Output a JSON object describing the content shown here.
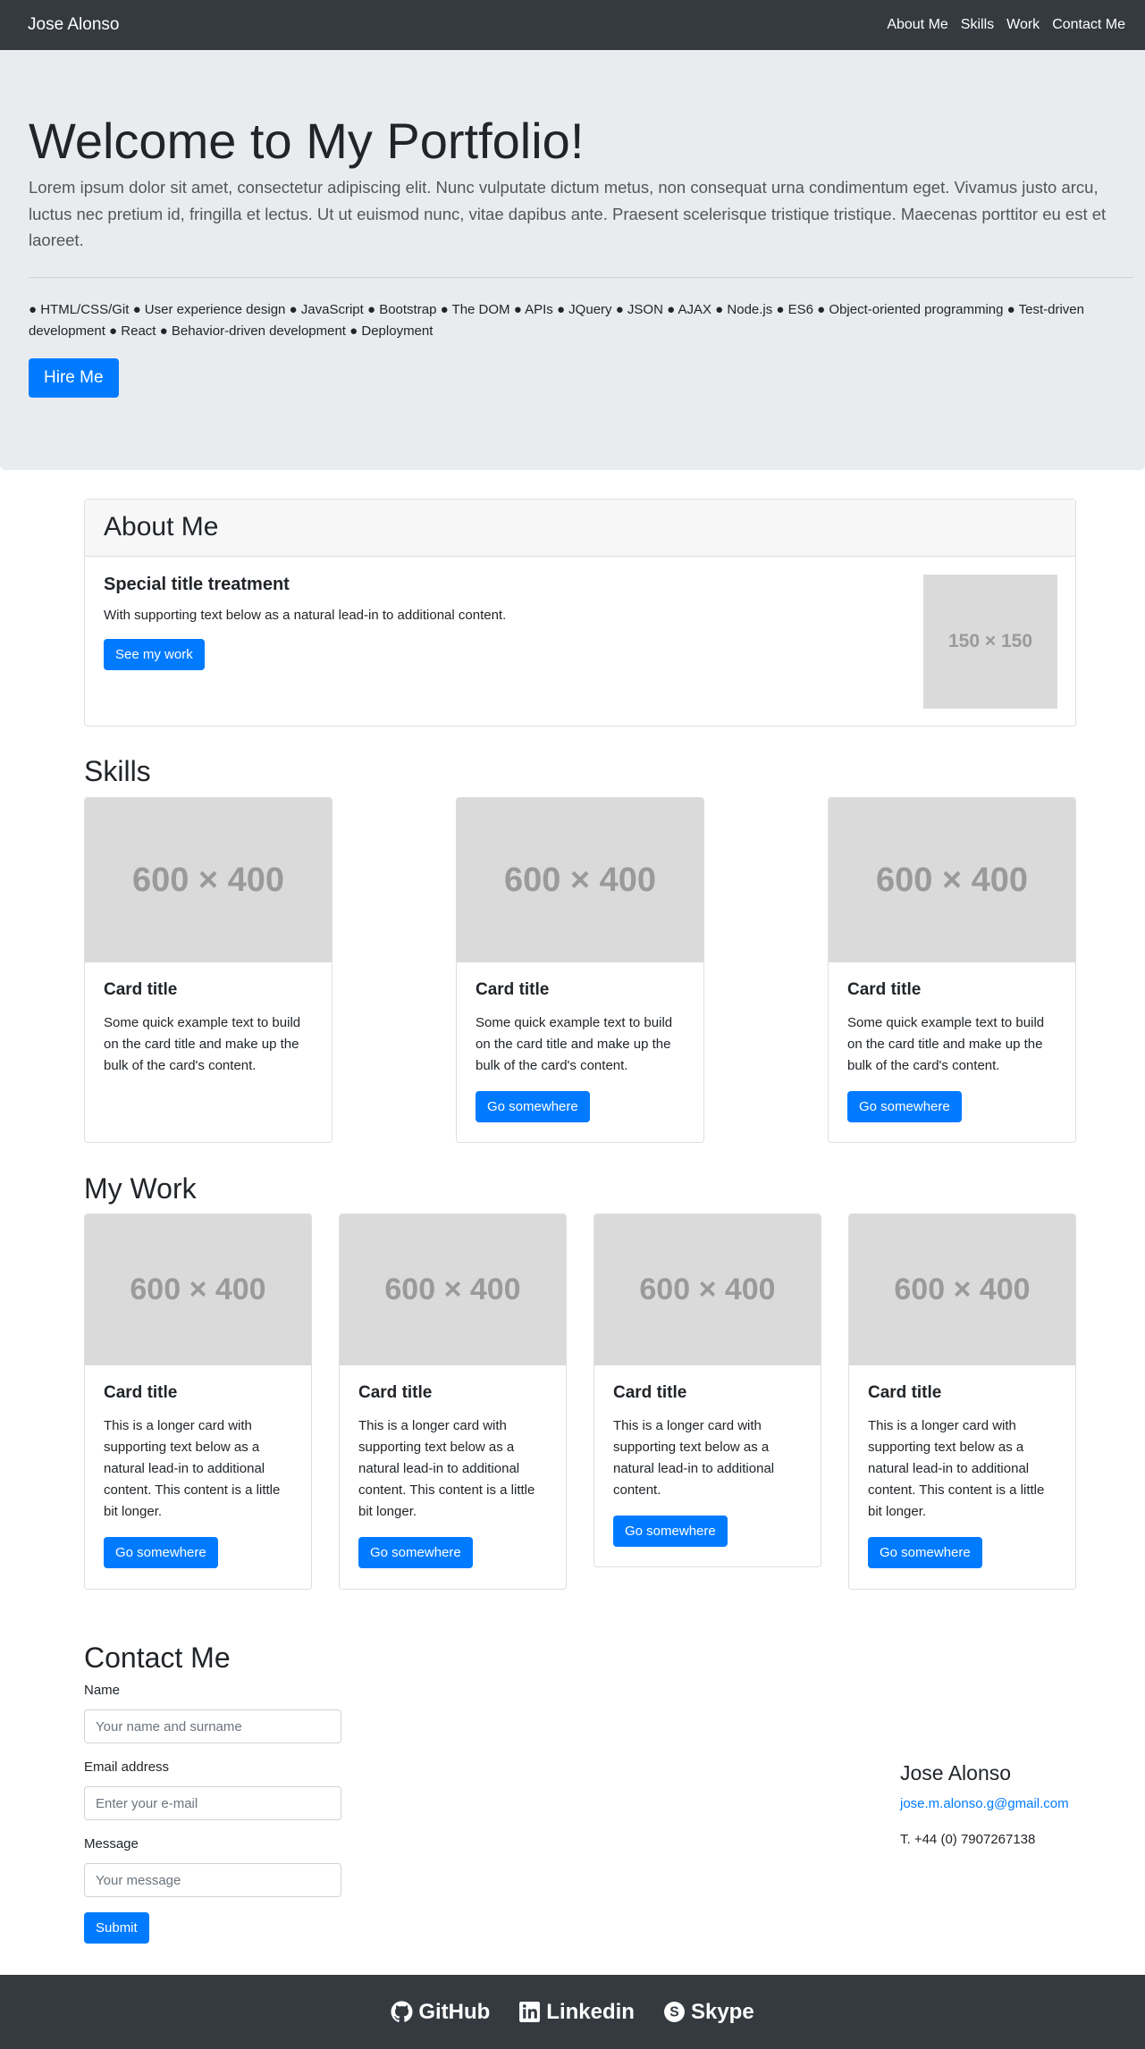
{
  "navbar": {
    "brand": "Jose Alonso",
    "links": [
      "About Me",
      "Skills",
      "Work",
      "Contact Me"
    ]
  },
  "jumbotron": {
    "title": "Welcome to My Portfolio!",
    "lead": "Lorem ipsum dolor sit amet, consectetur adipiscing elit. Nunc vulputate dictum metus, non consequat urna condimentum eget. Vivamus justo arcu, luctus nec pretium id, fringilla et lectus. Ut ut euismod nunc, vitae dapibus ante. Praesent scelerisque tristique tristique. Maecenas porttitor eu est et laoreet.",
    "skills": "● HTML/CSS/Git ● User experience design ● JavaScript ● Bootstrap ● The DOM ● APIs ● JQuery ● JSON ● AJAX ● Node.js ● ES6 ● Object-oriented programming ● Test-driven development ● React ● Behavior-driven development ● Deployment",
    "cta": "Hire Me"
  },
  "about": {
    "header": "About Me",
    "title": "Special title treatment",
    "text": "With supporting text below as a natural lead-in to additional content.",
    "button": "See my work",
    "image_label": "150 × 150"
  },
  "skills": {
    "heading": "Skills",
    "cards": [
      {
        "image": "600 × 400",
        "title": "Card title",
        "text": "Some quick example text to build on the card title and make up the bulk of the card's content."
      },
      {
        "image": "600 × 400",
        "title": "Card title",
        "text": "Some quick example text to build on the card title and make up the bulk of the card's content.",
        "button": "Go somewhere"
      },
      {
        "image": "600 × 400",
        "title": "Card title",
        "text": "Some quick example text to build on the card title and make up the bulk of the card's content.",
        "button": "Go somewhere"
      }
    ]
  },
  "work": {
    "heading": "My Work",
    "cards": [
      {
        "image": "600 × 400",
        "title": "Card title",
        "text": "This is a longer card with supporting text below as a natural lead-in to additional content. This content is a little bit longer.",
        "button": "Go somewhere"
      },
      {
        "image": "600 × 400",
        "title": "Card title",
        "text": "This is a longer card with supporting text below as a natural lead-in to additional content. This content is a little bit longer.",
        "button": "Go somewhere"
      },
      {
        "image": "600 × 400",
        "title": "Card title",
        "text": "This is a longer card with supporting text below as a natural lead-in to additional content.",
        "button": "Go somewhere"
      },
      {
        "image": "600 × 400",
        "title": "Card title",
        "text": "This is a longer card with supporting text below as a natural lead-in to additional content. This content is a little bit longer.",
        "button": "Go somewhere"
      }
    ]
  },
  "contact": {
    "heading": "Contact Me",
    "name_label": "Name",
    "name_placeholder": "Your name and surname",
    "email_label": "Email address",
    "email_placeholder": "Enter your e-mail",
    "message_label": "Message",
    "message_placeholder": "Your message",
    "submit": "Submit",
    "person": "Jose Alonso",
    "email": "jose.m.alonso.g@gmail.com",
    "phone": "T. +44 (0) 7907267138"
  },
  "footer": {
    "links": [
      "GitHub",
      "Linkedin",
      "Skype"
    ]
  },
  "colors": {
    "primary": "#007bff",
    "dark": "#343a40",
    "jumbotron_bg": "#e9ecef"
  }
}
